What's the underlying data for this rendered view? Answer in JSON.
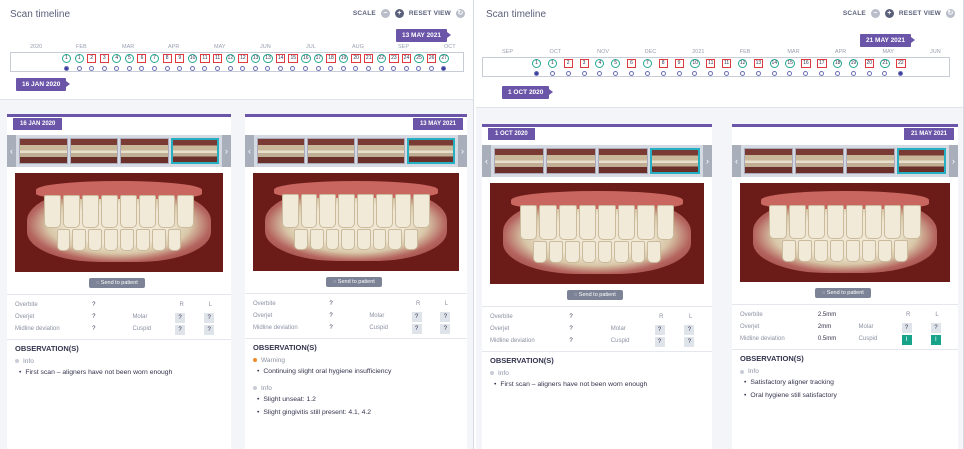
{
  "left": {
    "timeline": {
      "title": "Scan timeline",
      "scale_label": "SCALE",
      "reset_label": "RESET VIEW",
      "months": [
        "2020",
        "FEB",
        "MAR",
        "APR",
        "MAY",
        "JUN",
        "JUL",
        "AUG",
        "SEP",
        "OCT"
      ],
      "scans": [
        "1",
        "1",
        "2",
        "3",
        "4",
        "5",
        "6",
        "7",
        "8",
        "9",
        "10",
        "11",
        "11",
        "12",
        "12",
        "13",
        "13",
        "14",
        "15",
        "16",
        "17",
        "18",
        "19",
        "20",
        "21",
        "22",
        "23",
        "24",
        "25",
        "26",
        "27"
      ],
      "start_flag": "16 JAN 2020",
      "end_flag": "13 MAY 2021"
    },
    "compare": [
      {
        "date": "16 JAN 2020",
        "send": "Send to patient",
        "overbite_label": "Overbite",
        "overbite": "?",
        "overjet_label": "Overjet",
        "overjet": "?",
        "midline_label": "Midline deviation",
        "midline": "?",
        "r": "R",
        "l": "L",
        "molar_label": "Molar",
        "molar_r": "?",
        "molar_l": "?",
        "cuspid_label": "Cuspid",
        "cuspid_r": "?",
        "cuspid_l": "?",
        "obs_title": "OBSERVATION(S)",
        "groups": [
          {
            "cat": "Info",
            "level": "info",
            "items": [
              "First scan – aligners have not been worn enough"
            ]
          }
        ]
      },
      {
        "date": "13 MAY 2021",
        "send": "Send to patient",
        "overbite_label": "Overbite",
        "overbite": "?",
        "overjet_label": "Overjet",
        "overjet": "?",
        "midline_label": "Midline deviation",
        "midline": "?",
        "r": "R",
        "l": "L",
        "molar_label": "Molar",
        "molar_r": "?",
        "molar_l": "?",
        "cuspid_label": "Cuspid",
        "cuspid_r": "?",
        "cuspid_l": "?",
        "obs_title": "OBSERVATION(S)",
        "groups": [
          {
            "cat": "Warning",
            "level": "warning",
            "items": [
              "Continuing slight oral hygiene insufficiency"
            ]
          },
          {
            "cat": "Info",
            "level": "info",
            "items": [
              "Slight unseat: 1.2",
              "Slight gingivitis still present: 4.1, 4.2"
            ]
          }
        ]
      }
    ]
  },
  "right": {
    "timeline": {
      "title": "Scan timeline",
      "scale_label": "SCALE",
      "reset_label": "RESET VIEW",
      "months": [
        "SEP",
        "OCT",
        "NOV",
        "DEC",
        "2021",
        "FEB",
        "MAR",
        "APR",
        "MAY",
        "JUN"
      ],
      "scans": [
        "1",
        "1",
        "2",
        "3",
        "4",
        "5",
        "6",
        "7",
        "8",
        "9",
        "10",
        "11",
        "11",
        "12",
        "13",
        "14",
        "15",
        "16",
        "17",
        "18",
        "19",
        "20",
        "21",
        "22"
      ],
      "start_flag": "1 OCT 2020",
      "end_flag": "21 MAY 2021"
    },
    "compare": [
      {
        "date": "1 OCT 2020",
        "send": "Send to patient",
        "overbite_label": "Overbite",
        "overbite": "?",
        "overjet_label": "Overjet",
        "overjet": "?",
        "midline_label": "Midline deviation",
        "midline": "?",
        "r": "R",
        "l": "L",
        "molar_label": "Molar",
        "molar_r": "?",
        "molar_l": "?",
        "cuspid_label": "Cuspid",
        "cuspid_r": "?",
        "cuspid_l": "?",
        "obs_title": "OBSERVATION(S)",
        "groups": [
          {
            "cat": "Info",
            "level": "info",
            "items": [
              "First scan – aligners have not been worn enough"
            ]
          }
        ]
      },
      {
        "date": "21 MAY 2021",
        "send": "Send to patient",
        "overbite_label": "Overbite",
        "overbite": "2.5mm",
        "overjet_label": "Overjet",
        "overjet": "2mm",
        "midline_label": "Midline deviation",
        "midline": "0.5mm",
        "r": "R",
        "l": "L",
        "molar_label": "Molar",
        "molar_r": "?",
        "molar_l": "?",
        "cuspid_label": "Cuspid",
        "cuspid_r": "I",
        "cuspid_l": "I",
        "obs_title": "OBSERVATION(S)",
        "groups": [
          {
            "cat": "Info",
            "level": "info",
            "items": [
              "Satisfactory aligner tracking",
              "Oral hygiene still satisfactory"
            ]
          }
        ]
      }
    ]
  },
  "colors": {
    "accent": "#6b55a8",
    "scan_border": "#e0393e",
    "ok": "#17a38a",
    "warning": "#f08a2c"
  }
}
